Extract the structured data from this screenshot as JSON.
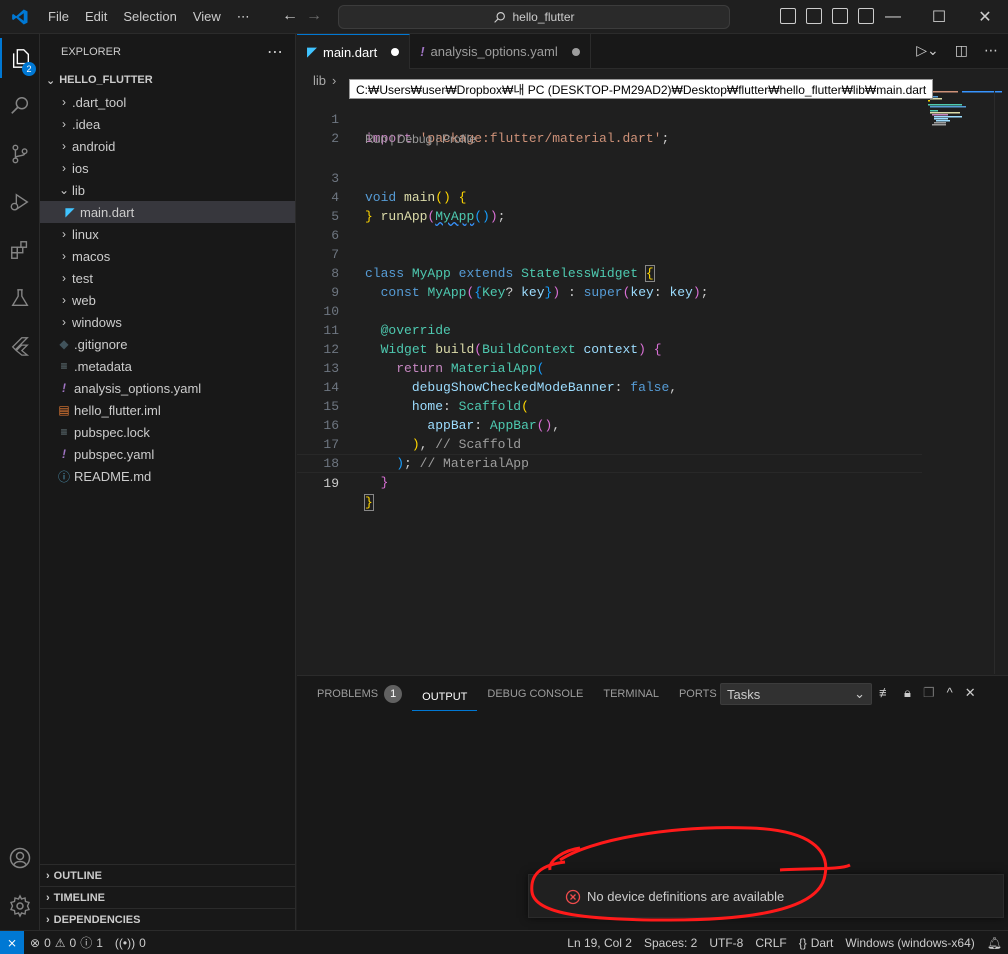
{
  "menu": [
    "File",
    "Edit",
    "Selection",
    "View",
    "⋯"
  ],
  "search": {
    "text": "hello_flutter"
  },
  "activity": {
    "explorer_badge": "2"
  },
  "sidebar": {
    "header": "EXPLORER",
    "root": "HELLO_FLUTTER",
    "items": [
      {
        "label": ".dart_tool",
        "type": "folder"
      },
      {
        "label": ".idea",
        "type": "folder"
      },
      {
        "label": "android",
        "type": "folder"
      },
      {
        "label": "ios",
        "type": "folder"
      },
      {
        "label": "lib",
        "type": "folder-open"
      },
      {
        "label": "main.dart",
        "type": "dart"
      },
      {
        "label": "linux",
        "type": "folder"
      },
      {
        "label": "macos",
        "type": "folder"
      },
      {
        "label": "test",
        "type": "folder"
      },
      {
        "label": "web",
        "type": "folder"
      },
      {
        "label": "windows",
        "type": "folder"
      },
      {
        "label": ".gitignore",
        "type": "git"
      },
      {
        "label": ".metadata",
        "type": "text"
      },
      {
        "label": "analysis_options.yaml",
        "type": "yaml"
      },
      {
        "label": "hello_flutter.iml",
        "type": "iml"
      },
      {
        "label": "pubspec.lock",
        "type": "text"
      },
      {
        "label": "pubspec.yaml",
        "type": "yaml"
      },
      {
        "label": "README.md",
        "type": "info"
      }
    ],
    "sections": [
      "OUTLINE",
      "TIMELINE",
      "DEPENDENCIES"
    ]
  },
  "tabs": [
    {
      "label": "main.dart",
      "active": true
    },
    {
      "label": "analysis_options.yaml",
      "active": false
    }
  ],
  "breadcrumb": {
    "first": "lib"
  },
  "tooltip": "C:₩Users₩user₩Dropbox₩내 PC (DESKTOP-PM29AD2)₩Desktop₩flutter₩hello_flutter₩lib₩main.dart",
  "codelens": "Run | Debug | Profile",
  "code": {
    "l1": "import 'package:flutter/material.dart';",
    "l2": "",
    "l3": "void main() {",
    "l4": "  runApp(MyApp());",
    "l5": "}",
    "l6": "",
    "l7": "class MyApp extends StatelessWidget {",
    "l8": "  const MyApp({Key? key}) : super(key: key);",
    "l9": "",
    "l10": "  @override",
    "l11": "  Widget build(BuildContext context) {",
    "l12": "    return MaterialApp(",
    "l13": "      debugShowCheckedModeBanner: false,",
    "l14": "      home: Scaffold(",
    "l15": "        appBar: AppBar(),",
    "l16": "      ), // Scaffold",
    "l17": "    ); // MaterialApp",
    "l18": "  }",
    "l19": "}"
  },
  "panel": {
    "tabs": [
      "PROBLEMS",
      "OUTPUT",
      "DEBUG CONSOLE",
      "TERMINAL",
      "PORTS"
    ],
    "problems_count": "1",
    "select_value": "Tasks"
  },
  "toast": {
    "message": "No device definitions are available"
  },
  "status": {
    "errors": "0",
    "warnings": "0",
    "info": "1",
    "ports": "0",
    "position": "Ln 19, Col 2",
    "spaces": "Spaces: 2",
    "encoding": "UTF-8",
    "eol": "CRLF",
    "language": "Dart",
    "device": "Windows (windows-x64)"
  }
}
